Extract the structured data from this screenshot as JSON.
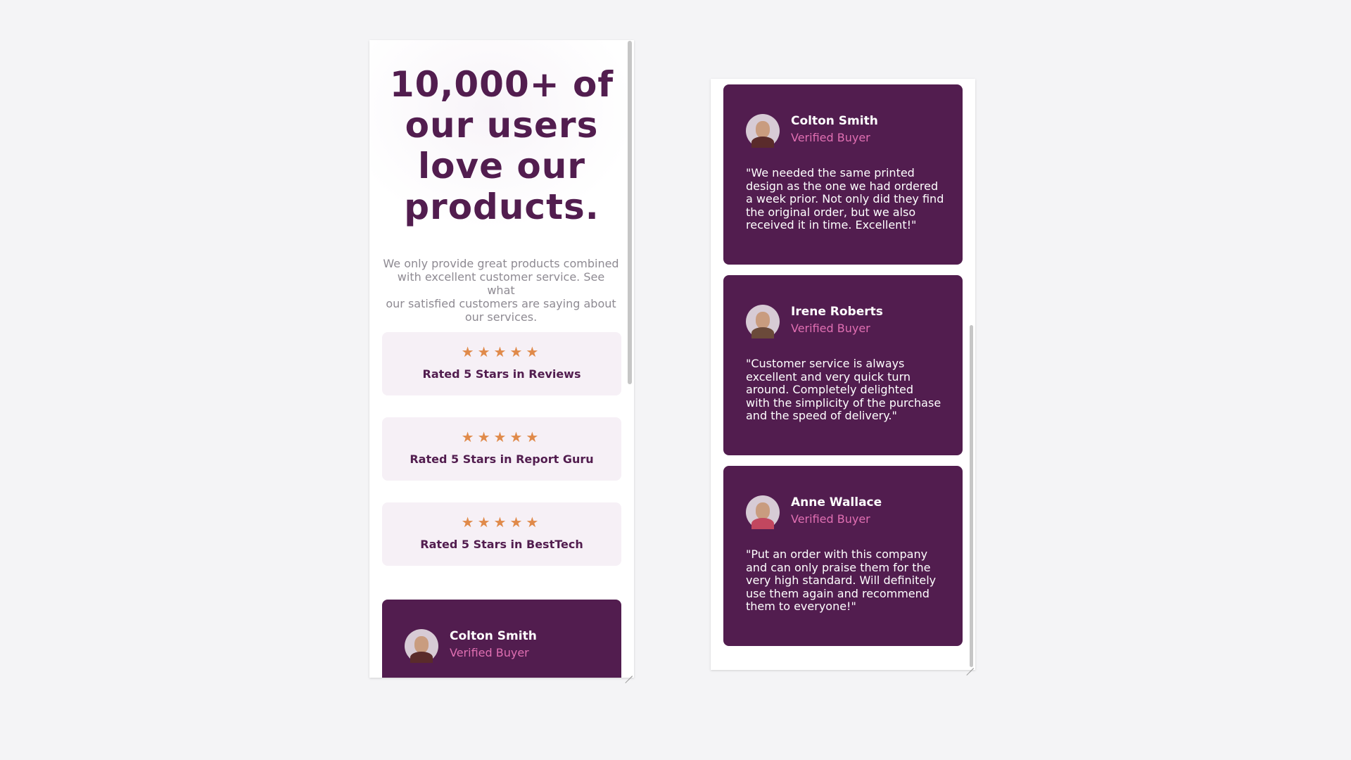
{
  "left_panel": {
    "heading_lines": [
      "10,000+ of",
      "our users",
      "love our",
      "products."
    ],
    "intro_lines": [
      "We only provide great products combined",
      "with excellent customer service. See what",
      "our satisfied customers are saying about",
      "our services."
    ],
    "ratings": [
      {
        "stars": "★★★★★",
        "label": "Rated 5 Stars in Reviews"
      },
      {
        "stars": "★★★★★",
        "label": "Rated 5 Stars in Report Guru"
      },
      {
        "stars": "★★★★★",
        "label": "Rated 5 Stars in BestTech"
      }
    ],
    "partial_testimonial": {
      "name": "Colton Smith",
      "role": "Verified Buyer"
    }
  },
  "testimonials": [
    {
      "name": "Colton Smith",
      "role": "Verified Buyer",
      "avatar_icon": "user-avatar-icon",
      "quote_lines": [
        "\"We needed the same printed",
        "design as the one we had ordered",
        "a week prior. Not only did they find",
        "the original order, but we also",
        "received it in time. Excellent!\""
      ]
    },
    {
      "name": "Irene Roberts",
      "role": "Verified Buyer",
      "avatar_icon": "user-avatar-icon",
      "quote_lines": [
        "\"Customer service is always",
        "excellent and very quick turn",
        "around. Completely delighted",
        "with the simplicity of the purchase",
        "and the speed of delivery.\""
      ]
    },
    {
      "name": "Anne Wallace",
      "role": "Verified Buyer",
      "avatar_icon": "user-avatar-icon",
      "quote_lines": [
        "\"Put an order with this company",
        "and can only praise them for the",
        "very high standard. Will definitely",
        "use them again and recommend",
        "them to everyone!\""
      ]
    }
  ],
  "colors": {
    "primary": "#521d4f",
    "accent_pink": "#e06fb2",
    "star": "#e08a4a",
    "rating_bg": "#f6f0f6",
    "page_bg": "#f4f4f6"
  }
}
